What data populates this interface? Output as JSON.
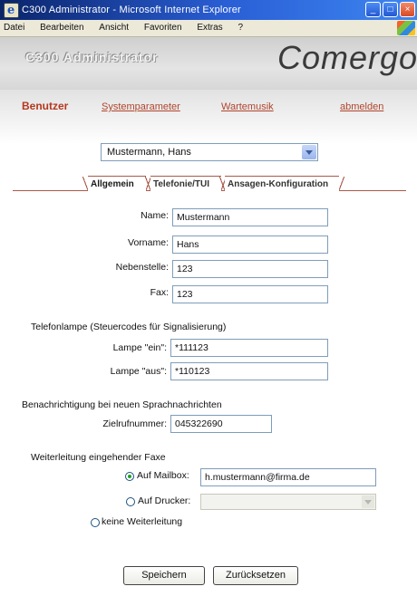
{
  "window": {
    "title": "C300 Administrator - Microsoft Internet Explorer",
    "controls": [
      "minimize-icon",
      "maximize-icon",
      "close-icon"
    ]
  },
  "menu": [
    "Datei",
    "Bearbeiten",
    "Ansicht",
    "Favoriten",
    "Extras",
    "?"
  ],
  "app": {
    "title": "C300 Administrator",
    "brand": "Comergo"
  },
  "nav": [
    {
      "label": "Benutzer",
      "active": true
    },
    {
      "label": "Systemparameter",
      "active": false
    },
    {
      "label": "Wartemusik",
      "active": false
    },
    {
      "label": "abmelden",
      "active": false
    }
  ],
  "user_select": {
    "value": "Mustermann, Hans"
  },
  "tabs": [
    {
      "label": "Allgemein",
      "active": true
    },
    {
      "label": "Telefonie/TUI",
      "active": false
    },
    {
      "label": "Ansagen-Konfiguration",
      "active": false
    }
  ],
  "form": {
    "name": {
      "label": "Name:",
      "value": "Mustermann"
    },
    "vorname": {
      "label": "Vorname:",
      "value": "Hans"
    },
    "nebenstelle": {
      "label": "Nebenstelle:",
      "value": "123"
    },
    "fax": {
      "label": "Fax:",
      "value": "123"
    },
    "lamp_section": "Telefonlampe (Steuercodes für Signalisierung)",
    "lamp_on": {
      "label": "Lampe \"ein\":",
      "value": "*111123"
    },
    "lamp_off": {
      "label": "Lampe \"aus\":",
      "value": "*110123"
    },
    "notify_section": "Benachrichtigung bei neuen Sprachnachrichten",
    "callback": {
      "label": "Zielrufnummer:",
      "value": "045322690"
    },
    "forward_section": "Weiterleitung eingehender Faxe",
    "mailbox": {
      "label": "Auf Mailbox:",
      "value": "h.mustermann@firma.de",
      "checked": true
    },
    "printer": {
      "label": "Auf Drucker:",
      "checked": false
    },
    "none": {
      "label": "keine Weiterleitung",
      "checked": false
    }
  },
  "buttons": {
    "save": "Speichern",
    "reset": "Zurücksetzen"
  },
  "colors": {
    "accent": "#b5381e",
    "title_bar": "#2a5fd6"
  }
}
